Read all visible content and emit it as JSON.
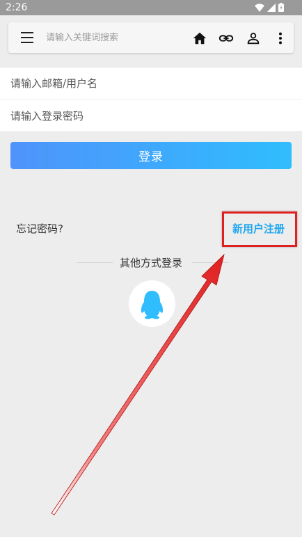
{
  "status_bar": {
    "time": "2:26",
    "icons": [
      "wifi-icon",
      "signal-icon",
      "battery-icon"
    ]
  },
  "toolbar": {
    "search_placeholder": "请输入关键词搜索",
    "icons": [
      "menu-icon",
      "home-icon",
      "link-icon",
      "person-icon",
      "more-vertical-icon"
    ]
  },
  "login_form": {
    "username_placeholder": "请输入邮箱/用户名",
    "password_placeholder": "请输入登录密码",
    "login_button": "登录"
  },
  "links": {
    "forgot_password": "忘记密码?",
    "register": "新用户注册"
  },
  "other_login": {
    "label": "其他方式登录",
    "icons": [
      "qq-penguin-icon"
    ]
  },
  "annotation": {
    "highlight_color": "#e02020",
    "arrow_color": "#e02020",
    "highlight_target": "新用户注册"
  },
  "colors": {
    "accent_start": "#4f93fb",
    "accent_end": "#2fbdfd",
    "link_blue": "#1ea6ef",
    "background": "#ededed"
  }
}
